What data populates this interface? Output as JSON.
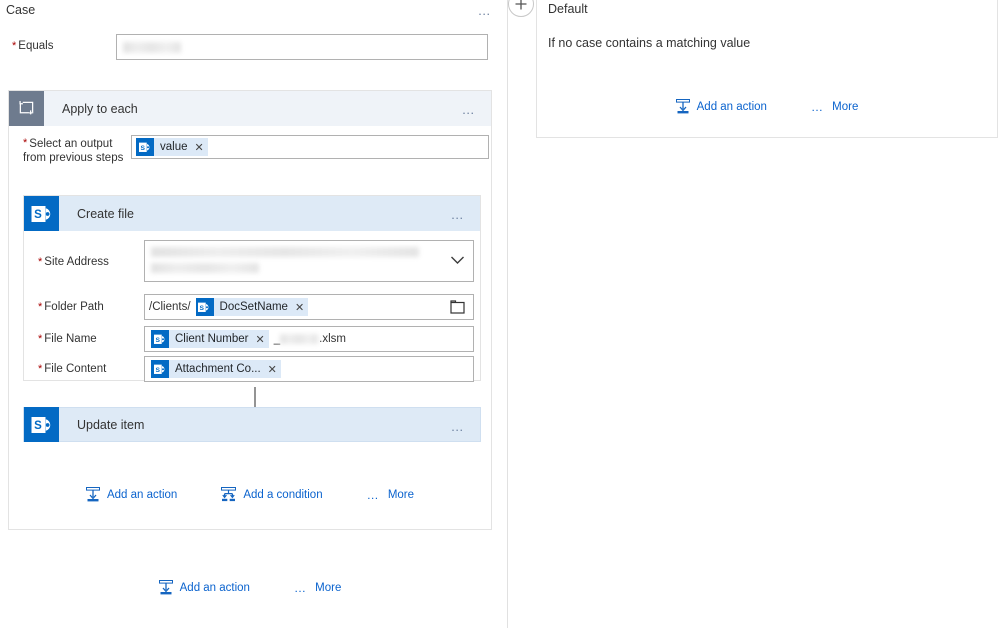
{
  "case_panel": {
    "title": "Case",
    "menu_icon": "ellipsis-icon",
    "equals": {
      "label": "Equals",
      "required": true,
      "value": "",
      "value_redacted": true
    },
    "apply_to_each": {
      "title": "Apply to each",
      "icon": "loop-icon",
      "icon_bg": "#6e7b8e",
      "header_bg": "#eff3f8",
      "menu_icon": "ellipsis-icon",
      "select_output": {
        "label_line1": "Select an output",
        "label_line2": "from previous steps",
        "required": true,
        "token": {
          "text": "value",
          "icon": "sharepoint-icon",
          "remove_icon": "close-icon"
        }
      },
      "create_file": {
        "title": "Create file",
        "icon": "sharepoint-icon",
        "icon_bg": "#036ac4",
        "header_bg": "#deeaf6",
        "menu_icon": "ellipsis-icon",
        "fields": [
          {
            "label": "Site Address",
            "required": true,
            "type": "dropdown",
            "value": "",
            "value_redacted": true,
            "trailing_icon": "chevron-down-icon"
          },
          {
            "label": "Folder Path",
            "required": true,
            "type": "token-input",
            "prefix_text": "/Clients/",
            "token": {
              "text": "DocSetName",
              "icon": "sharepoint-icon",
              "remove_icon": "close-icon"
            },
            "trailing_icon": "folder-icon"
          },
          {
            "label": "File Name",
            "required": true,
            "type": "token-input",
            "token": {
              "text": "Client Number",
              "icon": "sharepoint-icon",
              "remove_icon": "close-icon"
            },
            "suffix_separator": "_",
            "suffix_redacted": true,
            "suffix_extension": ".xlsm"
          },
          {
            "label": "File Content",
            "required": true,
            "type": "token-input",
            "token": {
              "text": "Attachment Co...",
              "icon": "sharepoint-icon",
              "remove_icon": "close-icon"
            }
          }
        ]
      },
      "update_item": {
        "title": "Update item",
        "icon": "sharepoint-icon",
        "icon_bg": "#036ac4",
        "header_bg": "#deeaf6",
        "menu_icon": "ellipsis-icon"
      },
      "actions": {
        "add_action": {
          "label": "Add an action",
          "icon": "add-action-icon"
        },
        "add_condition": {
          "label": "Add a condition",
          "icon": "add-condition-icon"
        },
        "more": {
          "label": "More",
          "icon": "ellipsis-icon"
        }
      }
    },
    "actions": {
      "add_action": {
        "label": "Add an action",
        "icon": "add-action-icon"
      },
      "more": {
        "label": "More",
        "icon": "ellipsis-icon"
      }
    }
  },
  "add_case_button": {
    "icon": "plus-icon",
    "label": ""
  },
  "default_panel": {
    "title": "Default",
    "subtitle": "If no case contains a matching value",
    "actions": {
      "add_action": {
        "label": "Add an action",
        "icon": "add-action-icon"
      },
      "more": {
        "label": "More",
        "icon": "ellipsis-icon"
      }
    }
  },
  "colors": {
    "accent_link": "#0b63ce",
    "sharepoint_blue": "#036ac4",
    "loop_gray": "#6e7b8e",
    "card_header_blue": "#deeaf6",
    "apply_header_blue": "#eff3f8",
    "required_star": "#a80000",
    "border_gray": "#e3e3e3"
  }
}
